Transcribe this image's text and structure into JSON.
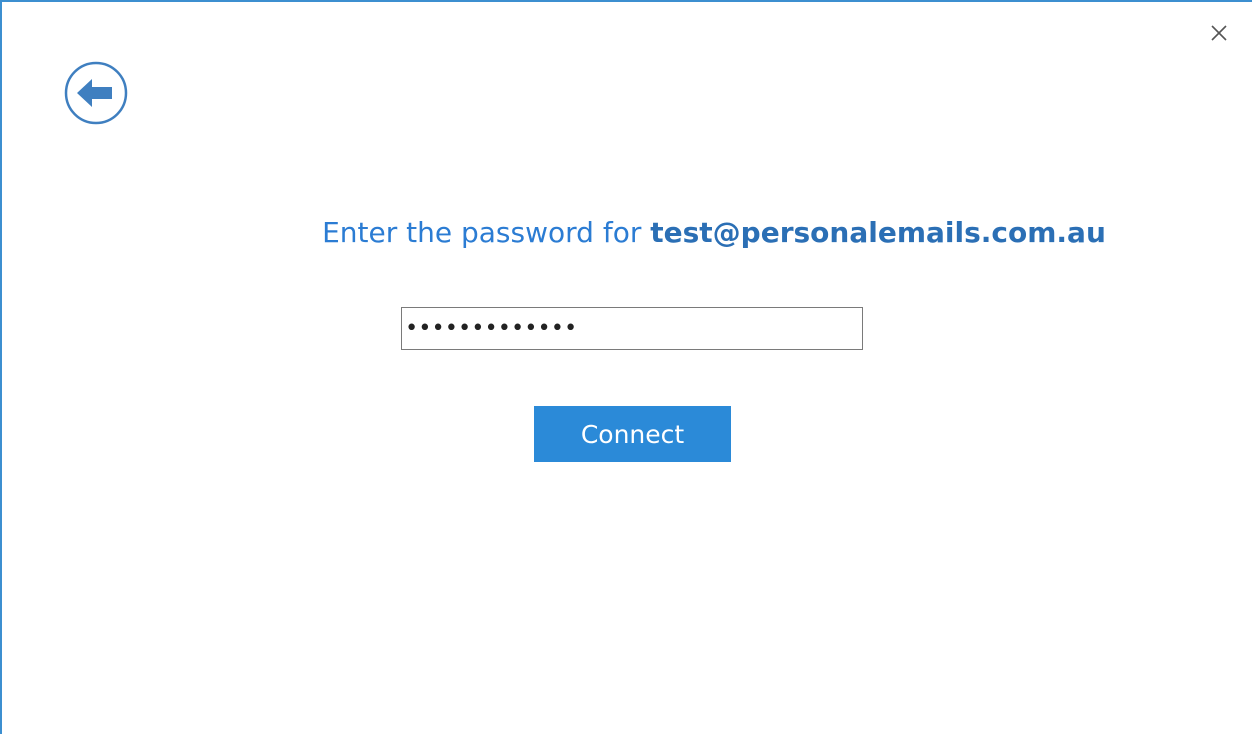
{
  "dialog": {
    "prompt_prefix": "Enter the password for",
    "email": "test@personalemails.com.au",
    "password_value": "•••••••••••••",
    "connect_label": "Connect",
    "close_glyph": "×"
  },
  "icons": {
    "back": "back-arrow-icon",
    "close": "close-icon"
  },
  "colors": {
    "accent": "#2b8ad8",
    "prompt_text": "#2b7cd3",
    "window_border": "#3c8fd0",
    "back_icon": "#3f7fc0"
  }
}
